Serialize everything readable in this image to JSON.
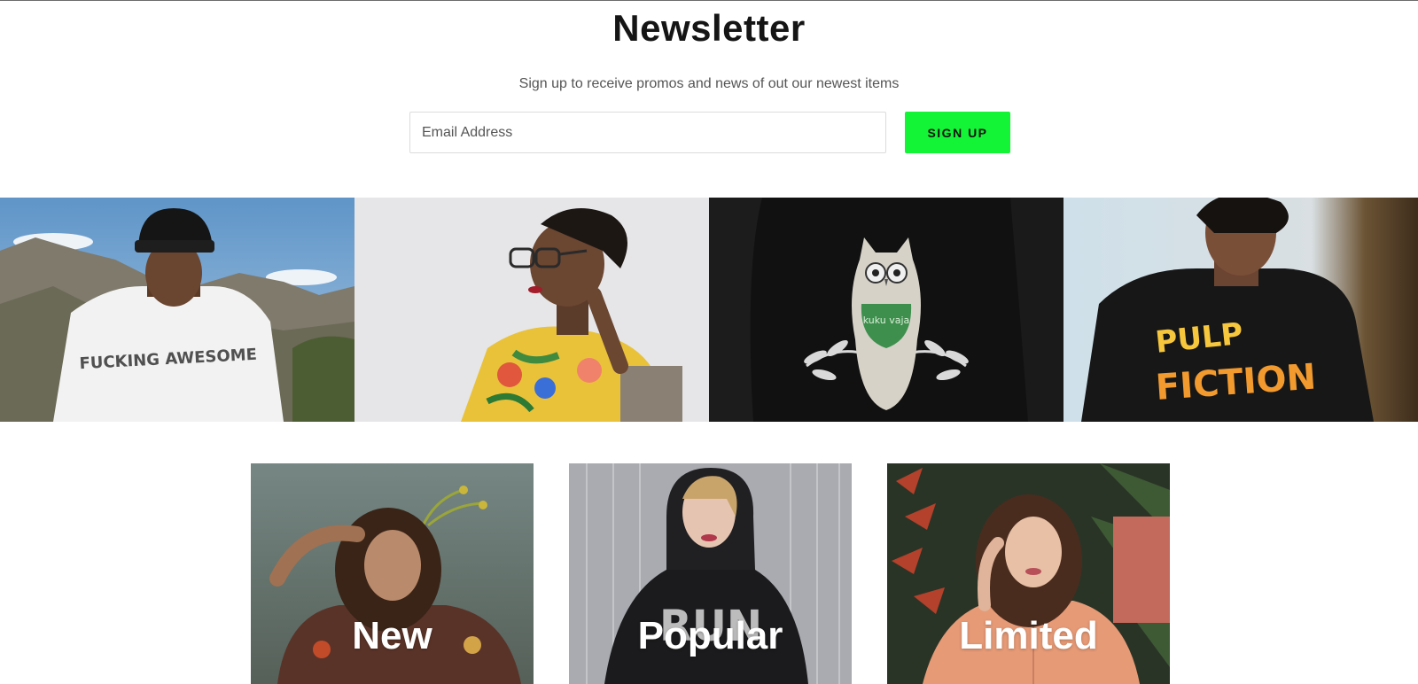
{
  "newsletter": {
    "title": "Newsletter",
    "subtitle": "Sign up to receive promos and news of out our newest items",
    "email_placeholder": "Email Address",
    "button_label": "SIGN UP",
    "accent_color": "#14f436"
  },
  "gallery": {
    "tiles": [
      {
        "subject": "man in white t-shirt and beanie, mountains background",
        "shirt_text": "FUCKING AWESOME"
      },
      {
        "subject": "woman in glasses with floral top",
        "shirt_text": ""
      },
      {
        "subject": "black t-shirt with owl print",
        "shirt_text": "kuku vaja"
      },
      {
        "subject": "woman in black t-shirt",
        "shirt_text": "PULP FICTION"
      }
    ]
  },
  "categories": [
    {
      "label": "New"
    },
    {
      "label": "Popular",
      "shirt_text": "RUN"
    },
    {
      "label": "Limited"
    }
  ]
}
